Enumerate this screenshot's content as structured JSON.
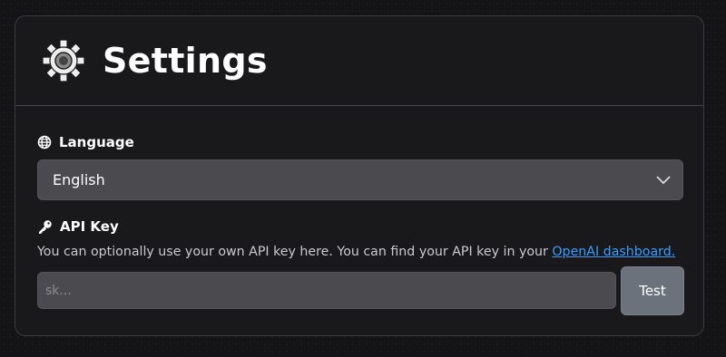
{
  "header": {
    "title": "Settings",
    "icon": "gear-icon"
  },
  "language": {
    "label": "Language",
    "icon": "globe-icon",
    "selected": "English"
  },
  "api_key": {
    "label": "API Key",
    "icon": "key-icon",
    "help_text": "You can optionally use your own API key here. You can find your API key in your ",
    "link_text": "OpenAI dashboard.",
    "placeholder": "sk...",
    "test_button": "Test"
  },
  "colors": {
    "panel_bg": "#19191c",
    "field_bg": "#4a4a4f",
    "link": "#3b9dff",
    "button_bg": "#6c727c"
  }
}
